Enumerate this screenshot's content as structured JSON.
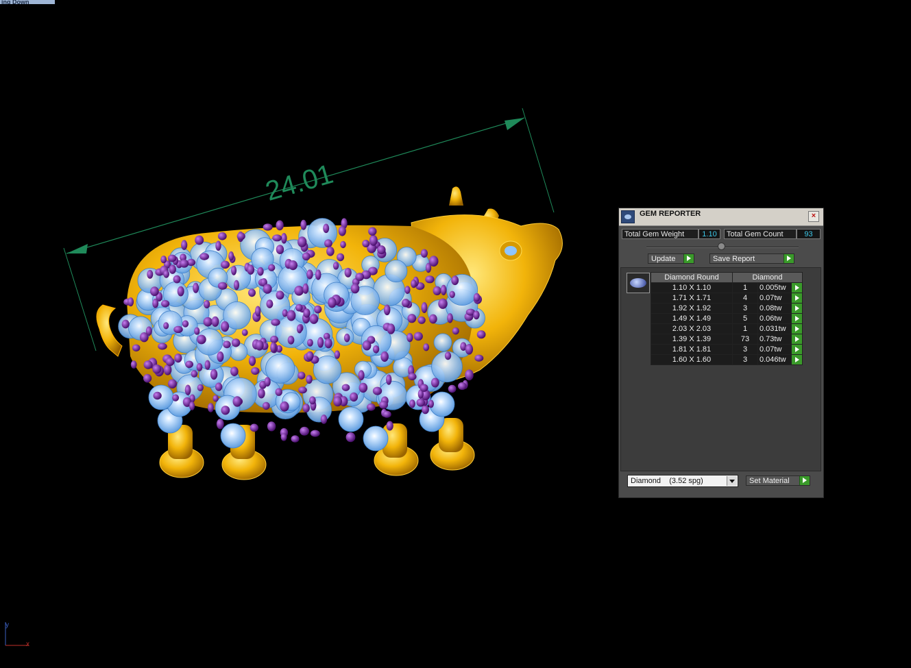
{
  "viewport": {
    "label": "ing Down",
    "dimension_value": "24.01"
  },
  "axes": {
    "y": "y",
    "x": "x"
  },
  "gem_reporter": {
    "title": "GEM REPORTER",
    "close_glyph": "×",
    "total_weight_label": "Total Gem Weight",
    "total_weight_value": "1.10",
    "total_count_label": "Total Gem Count",
    "total_count_value": "93",
    "update_label": "Update",
    "save_report_label": "Save Report",
    "table": {
      "col_shape": "Diamond Round",
      "col_material": "Diamond",
      "rows": [
        {
          "size": "1.10 X 1.10",
          "count": "1",
          "weight": "0.005tw"
        },
        {
          "size": "1.71 X 1.71",
          "count": "4",
          "weight": "0.07tw"
        },
        {
          "size": "1.92 X 1.92",
          "count": "3",
          "weight": "0.08tw"
        },
        {
          "size": "1.49 X 1.49",
          "count": "5",
          "weight": "0.06tw"
        },
        {
          "size": "2.03 X 2.03",
          "count": "1",
          "weight": "0.031tw"
        },
        {
          "size": "1.39 X 1.39",
          "count": "73",
          "weight": "0.73tw"
        },
        {
          "size": "1.81 X 1.81",
          "count": "3",
          "weight": "0.07tw"
        },
        {
          "size": "1.60 X 1.60",
          "count": "3",
          "weight": "0.046tw"
        }
      ]
    },
    "material_select": "Diamond    (3.52 spg)",
    "set_material_label": "Set Material"
  },
  "colors": {
    "gold": "#f2b40a",
    "gem_blue": "#8ec5ff",
    "prong_purple": "#6a1f8e",
    "dimension_green": "#1f8a5a"
  }
}
